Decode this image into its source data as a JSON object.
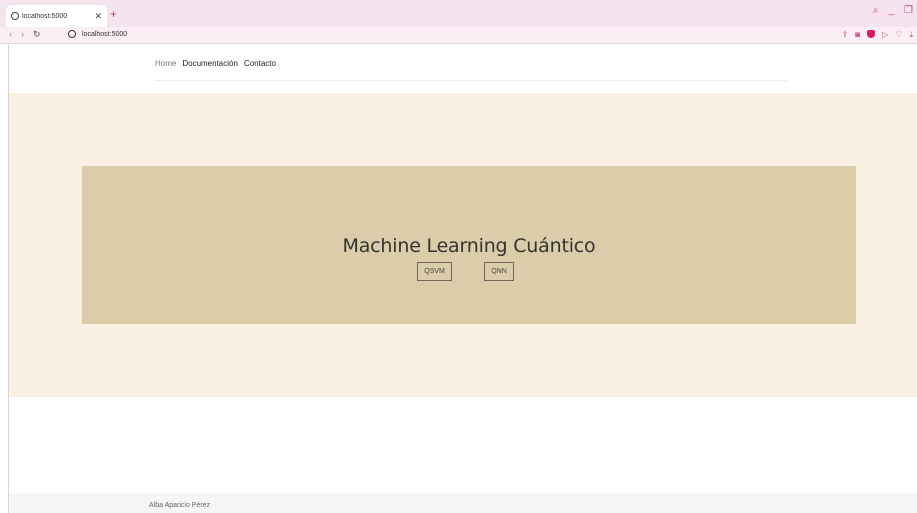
{
  "browser": {
    "tab_title": "localhost:5000",
    "tab_close": "✕",
    "new_tab": "+",
    "url": "localhost:5000",
    "accent": "#c24a7a"
  },
  "nav": {
    "home": "Home",
    "docs": "Documentación",
    "contact": "Contacto"
  },
  "hero": {
    "title": "Machine Learning Cuántico",
    "button_qsvm": "QSVM",
    "button_qnn": "QNN",
    "background": "#f9f0e2",
    "panel_color": "#dbcdaa"
  },
  "footer": {
    "author": "Alba Aparicio Pérez"
  }
}
